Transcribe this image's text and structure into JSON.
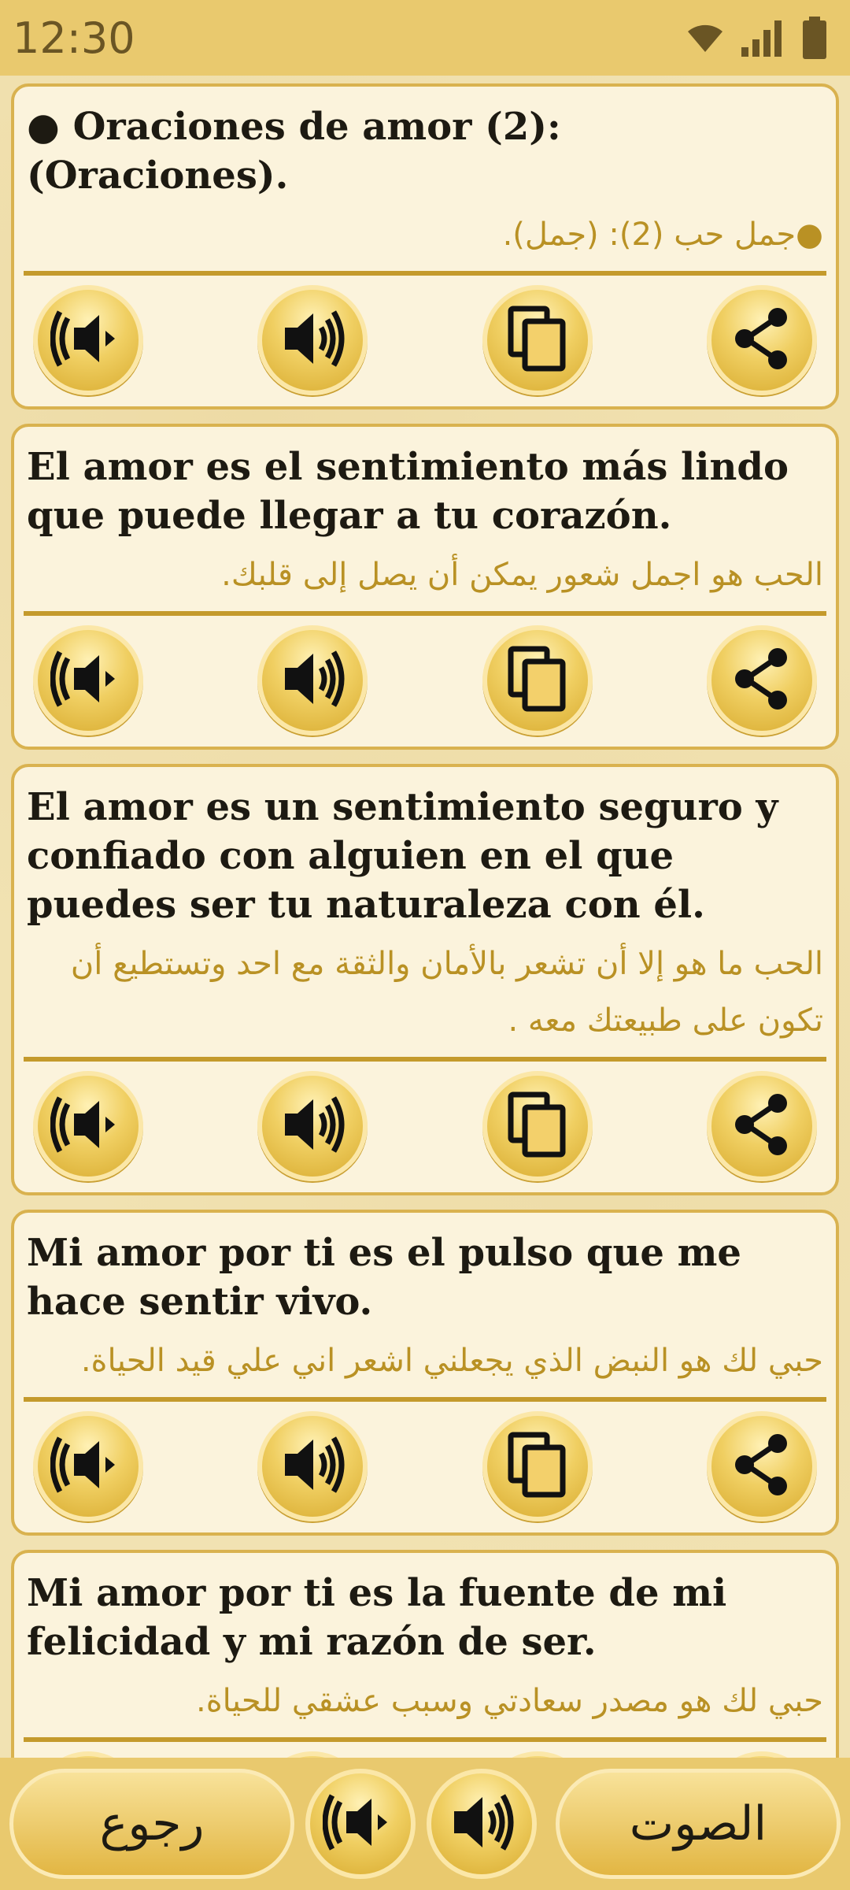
{
  "status_bar": {
    "time": "12:30",
    "wifi_icon": "wifi-icon",
    "signal_icon": "signal-icon",
    "battery_icon": "battery-icon"
  },
  "cards": [
    {
      "spanish": "● Oraciones de amor (2): (Oraciones).",
      "arabic": "●جمل حب (2): (جمل)."
    },
    {
      "spanish": "El amor es el sentimiento más lindo que puede llegar a tu corazón.",
      "arabic": "الحب هو اجمل شعور يمكن أن يصل إلى قلبك."
    },
    {
      "spanish": "El amor es un sentimiento seguro y confiado con alguien en el que puedes ser tu naturaleza con él.",
      "arabic": "الحب ما هو  إلا أن تشعر بالأمان والثقة مع احد وتستطيع أن تكون على طبيعتك معه ."
    },
    {
      "spanish": "Mi amor por ti es el pulso que me hace sentir vivo.",
      "arabic": "حبي لك هو النبض الذي يجعلني اشعر اني علي قيد الحياة."
    },
    {
      "spanish": "Mi amor por ti es la fuente de mi felicidad y mi razón de ser.",
      "arabic": "حبي لك هو مصدر سعادتي وسبب عشقي للحياة."
    }
  ],
  "card_actions": [
    "slow-speaker-icon",
    "speaker-icon",
    "copy-icon",
    "share-icon"
  ],
  "bottom_bar": {
    "back_label": "رجوع",
    "sound_label": "الصوت",
    "slow_icon": "slow-speaker-icon",
    "speaker_icon": "speaker-icon"
  },
  "colors": {
    "accent": "#e9c96e",
    "gold_text": "#b99124",
    "divider": "#c49a2c"
  }
}
